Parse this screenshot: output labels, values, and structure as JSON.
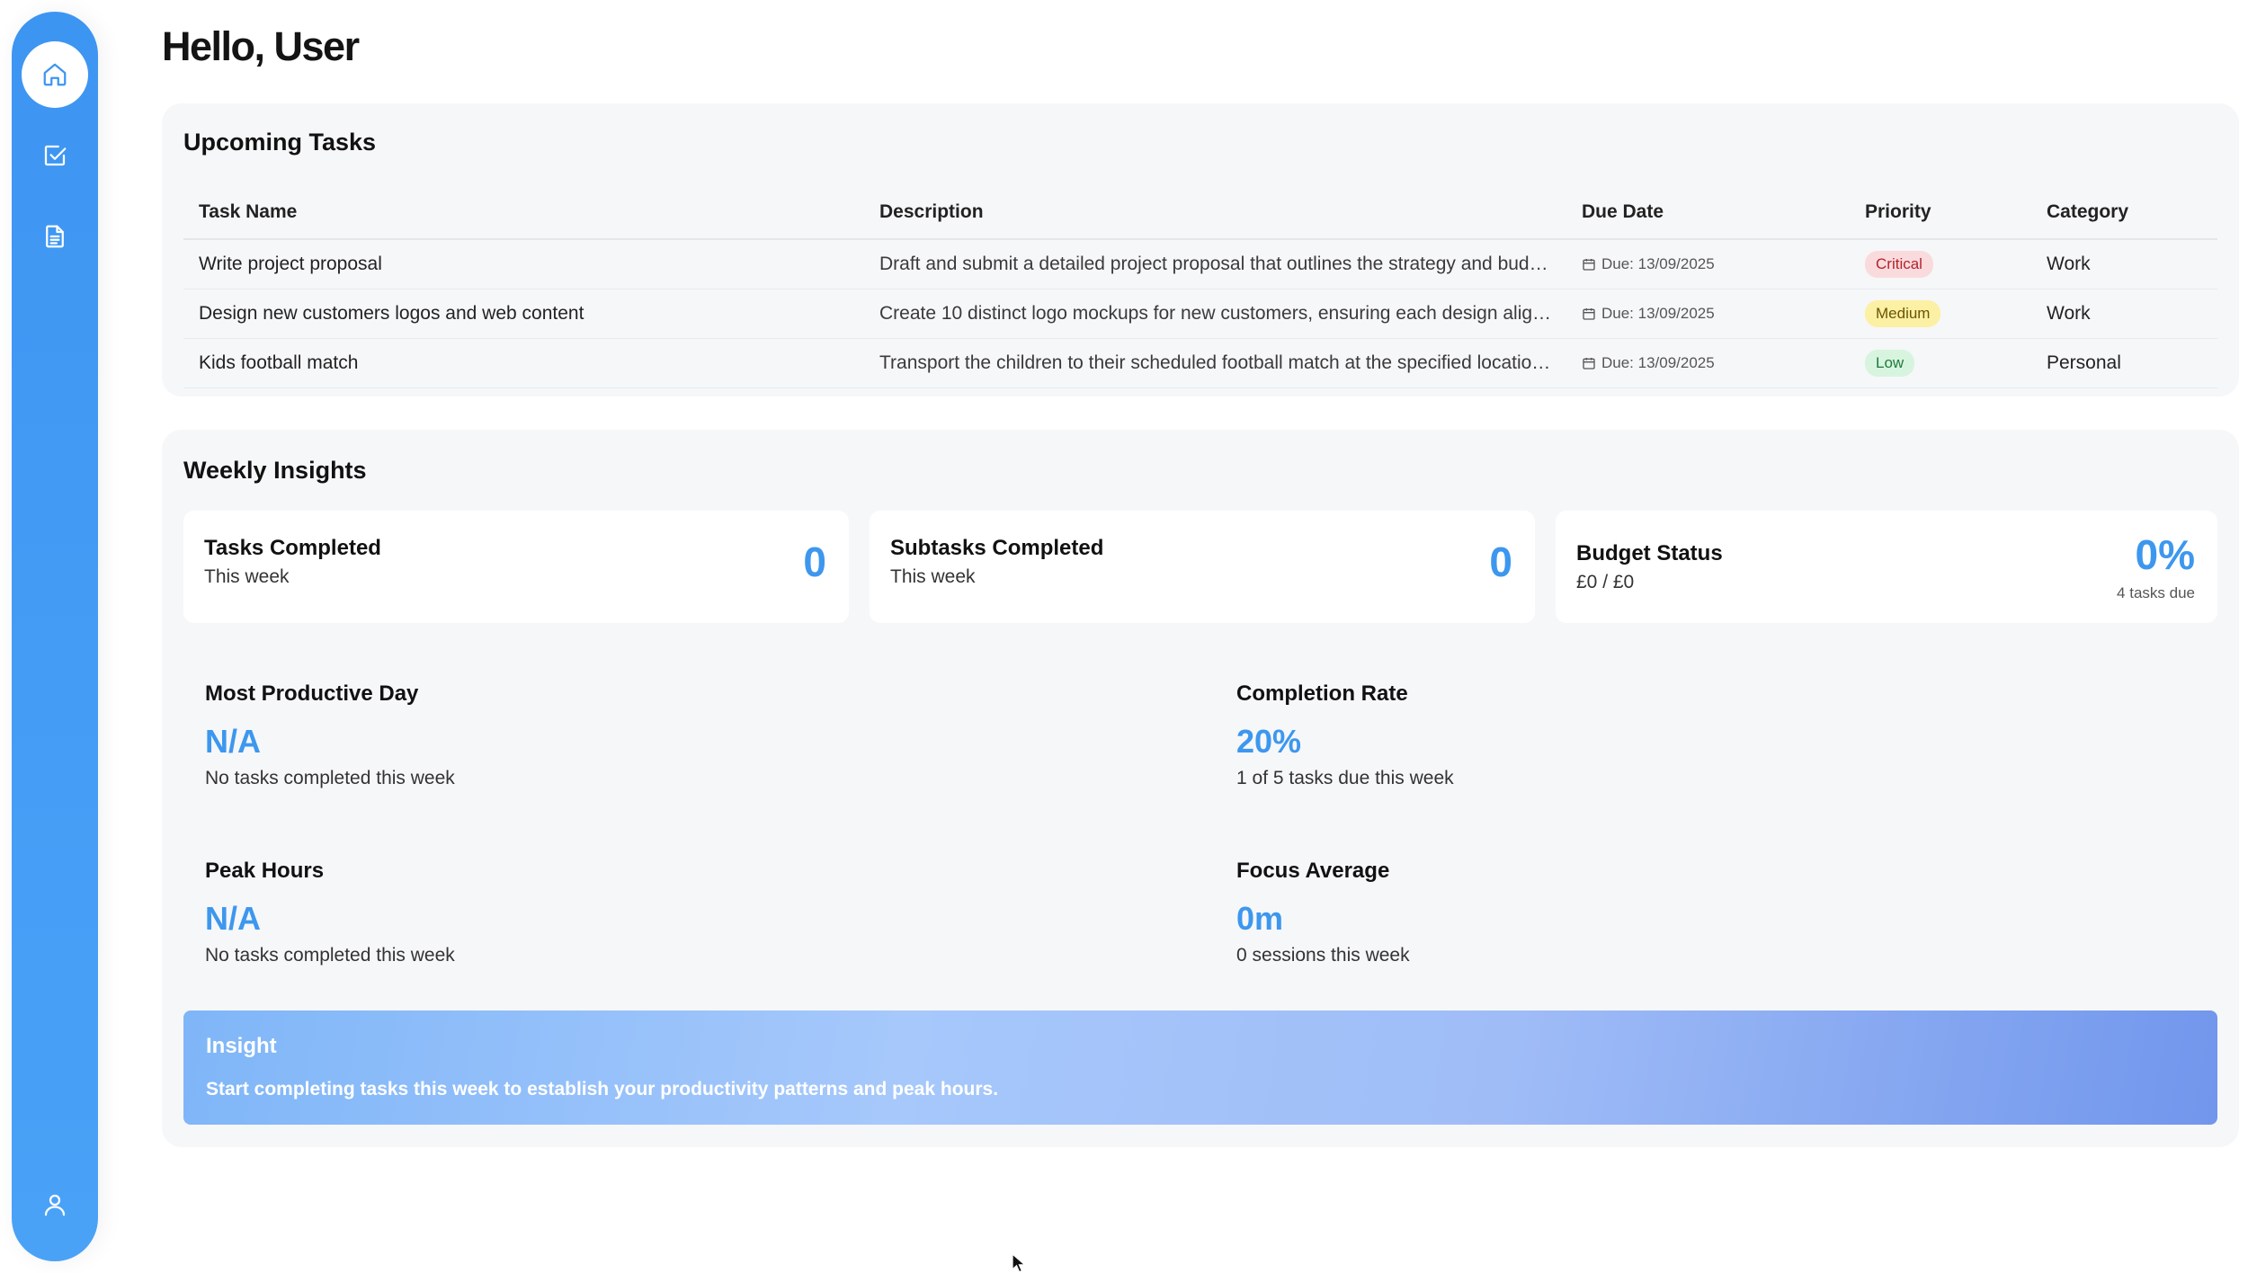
{
  "sidebar": {
    "items": [
      {
        "icon": "home-icon",
        "active": true
      },
      {
        "icon": "checkbox-icon",
        "active": false
      },
      {
        "icon": "document-icon",
        "active": false
      }
    ],
    "bottom_icon": "user-icon",
    "accent": "#3d95f2"
  },
  "header": {
    "greeting": "Hello, User"
  },
  "upcoming_tasks": {
    "title": "Upcoming Tasks",
    "columns": [
      "Task Name",
      "Description",
      "Due Date",
      "Priority",
      "Category"
    ],
    "rows": [
      {
        "name": "Write project proposal",
        "description": "Draft and submit a detailed project proposal that outlines the strategy and bud…",
        "due": "Due: 13/09/2025",
        "priority": "Critical",
        "category": "Work"
      },
      {
        "name": "Design new customers logos and web content",
        "description": "Create 10 distinct logo mockups for new customers, ensuring each design alig…",
        "due": "Due: 13/09/2025",
        "priority": "Medium",
        "category": "Work"
      },
      {
        "name": "Kids football match",
        "description": "Transport the children to their scheduled football match at the specified locatio…",
        "due": "Due: 13/09/2025",
        "priority": "Low",
        "category": "Personal"
      }
    ]
  },
  "weekly_insights": {
    "title": "Weekly Insights",
    "cards": {
      "tasks_completed": {
        "title": "Tasks Completed",
        "sub": "This week",
        "value": "0"
      },
      "subtasks_completed": {
        "title": "Subtasks Completed",
        "sub": "This week",
        "value": "0"
      },
      "budget_status": {
        "title": "Budget Status",
        "sub": "£0 / £0",
        "value": "0%",
        "note": "4 tasks due"
      }
    },
    "metrics": {
      "most_productive_day": {
        "title": "Most Productive Day",
        "value": "N/A",
        "sub": "No tasks completed this week"
      },
      "completion_rate": {
        "title": "Completion Rate",
        "value": "20%",
        "sub": "1 of 5 tasks due this week"
      },
      "peak_hours": {
        "title": "Peak Hours",
        "value": "N/A",
        "sub": "No tasks completed this week"
      },
      "focus_average": {
        "title": "Focus Average",
        "value": "0m",
        "sub": "0 sessions this week"
      }
    },
    "insight": {
      "title": "Insight",
      "text": "Start completing tasks this week to establish your productivity patterns and peak hours."
    }
  }
}
